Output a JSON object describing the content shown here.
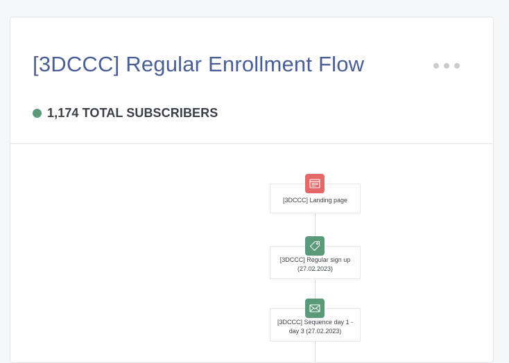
{
  "flow": {
    "title": "[3DCCC] Regular Enrollment Flow",
    "subscribers_label": "1,174 TOTAL SUBSCRIBERS",
    "status_color": "#5a9a78"
  },
  "nodes": [
    {
      "label": "[3DCCC] Landing page",
      "icon": "landing-page-icon",
      "color": "#e56869"
    },
    {
      "label": "[3DCCC] Regular sign up (27.02.2023)",
      "icon": "tag-icon",
      "color": "#5a9a78"
    },
    {
      "label": "[3DCCC] Sequence day 1 - day 3 (27.02.2023)",
      "icon": "envelope-icon",
      "color": "#5a9a78"
    }
  ]
}
